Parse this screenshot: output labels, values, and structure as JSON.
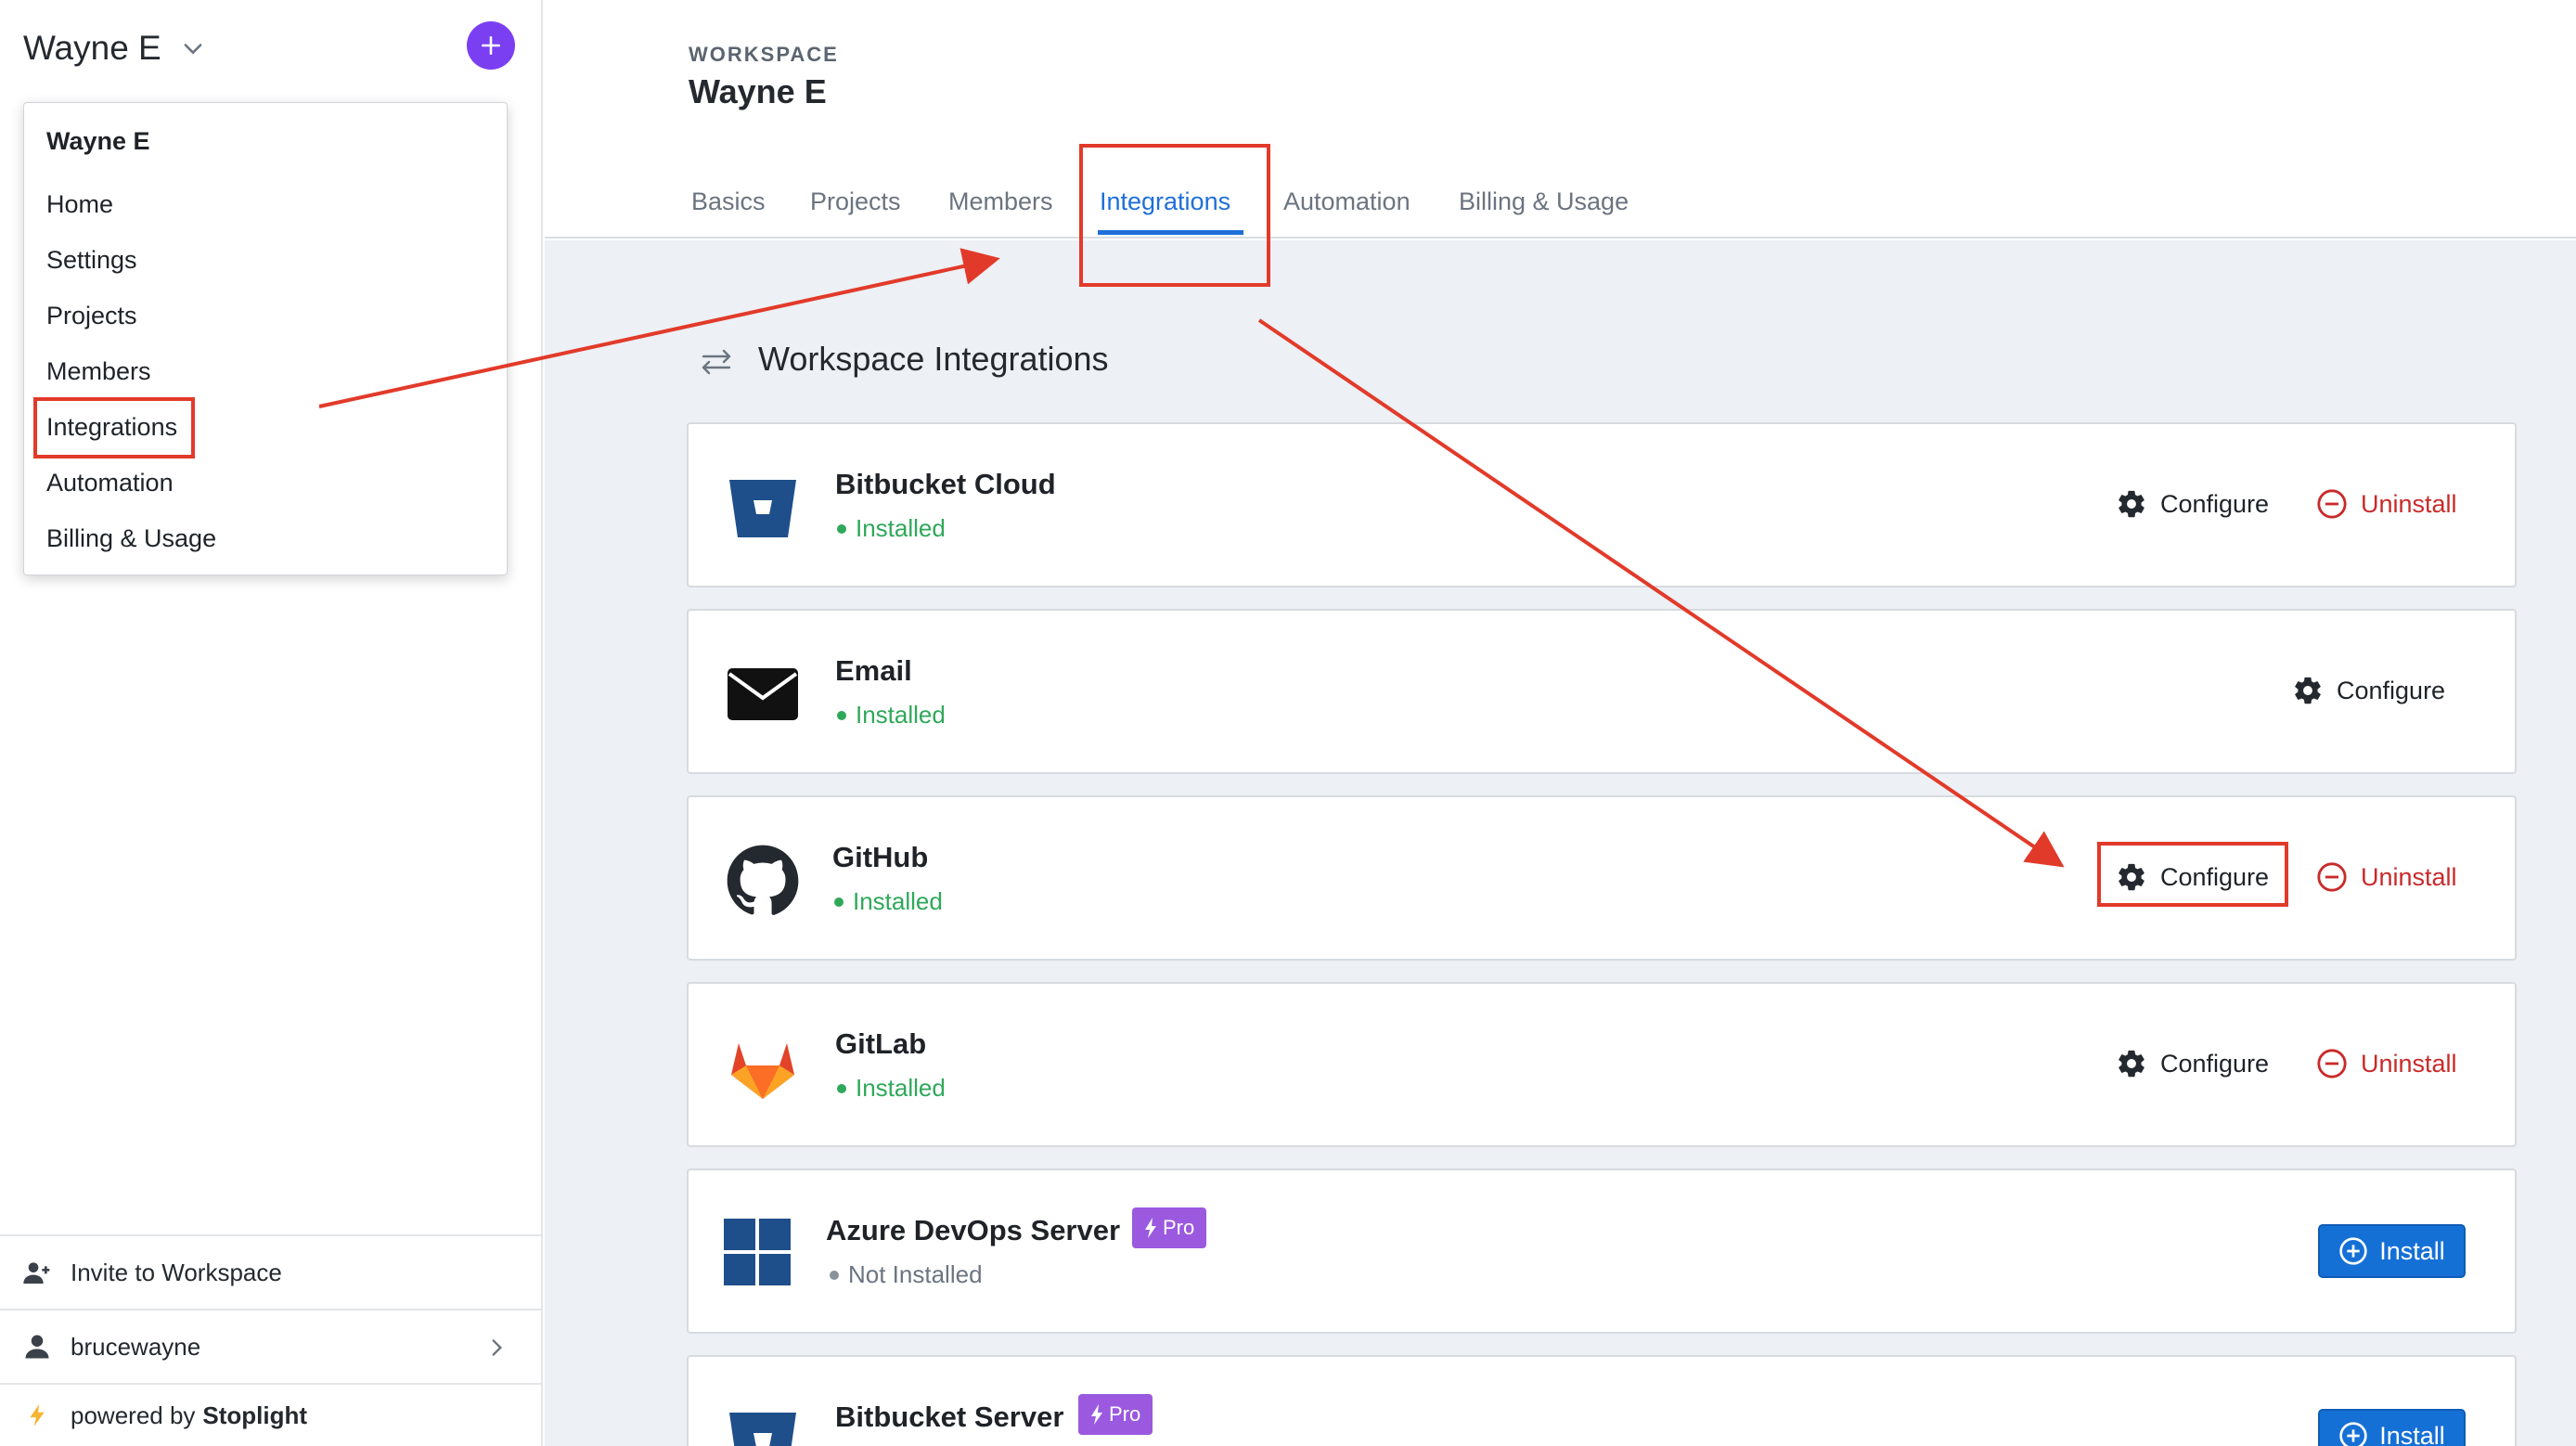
{
  "sidebar": {
    "workspace_name": "Wayne E",
    "menu": {
      "header": "Wayne E",
      "items": [
        "Home",
        "Settings",
        "Projects",
        "Members",
        "Integrations",
        "Automation",
        "Billing & Usage"
      ]
    },
    "invite_label": "Invite to Workspace",
    "user_label": "brucewayne",
    "powered_prefix": "powered by",
    "powered_brand": "Stoplight"
  },
  "header": {
    "workspace_label": "WORKSPACE",
    "workspace_title": "Wayne E",
    "tabs": [
      "Basics",
      "Projects",
      "Members",
      "Integrations",
      "Automation",
      "Billing & Usage"
    ],
    "active_tab": "Integrations"
  },
  "main": {
    "section_title": "Workspace Integrations",
    "configure_label": "Configure",
    "uninstall_label": "Uninstall",
    "install_label": "Install",
    "pro_label": "Pro",
    "integrations": [
      {
        "name": "Bitbucket Cloud",
        "status": "Installed",
        "icon": "bitbucket-icon"
      },
      {
        "name": "Email",
        "status": "Installed",
        "icon": "envelope-icon"
      },
      {
        "name": "GitHub",
        "status": "Installed",
        "icon": "github-icon"
      },
      {
        "name": "GitLab",
        "status": "Installed",
        "icon": "gitlab-icon"
      },
      {
        "name": "Azure DevOps Server",
        "status": "Not Installed",
        "icon": "windows-icon"
      },
      {
        "name": "Bitbucket Server",
        "status": "",
        "icon": "bitbucket-icon"
      }
    ]
  },
  "colors": {
    "accent": "#1e6fd9",
    "installed": "#2fa85a",
    "danger": "#c92a2a",
    "pro": "#9b59e0",
    "annotation": "#e23a2a"
  }
}
